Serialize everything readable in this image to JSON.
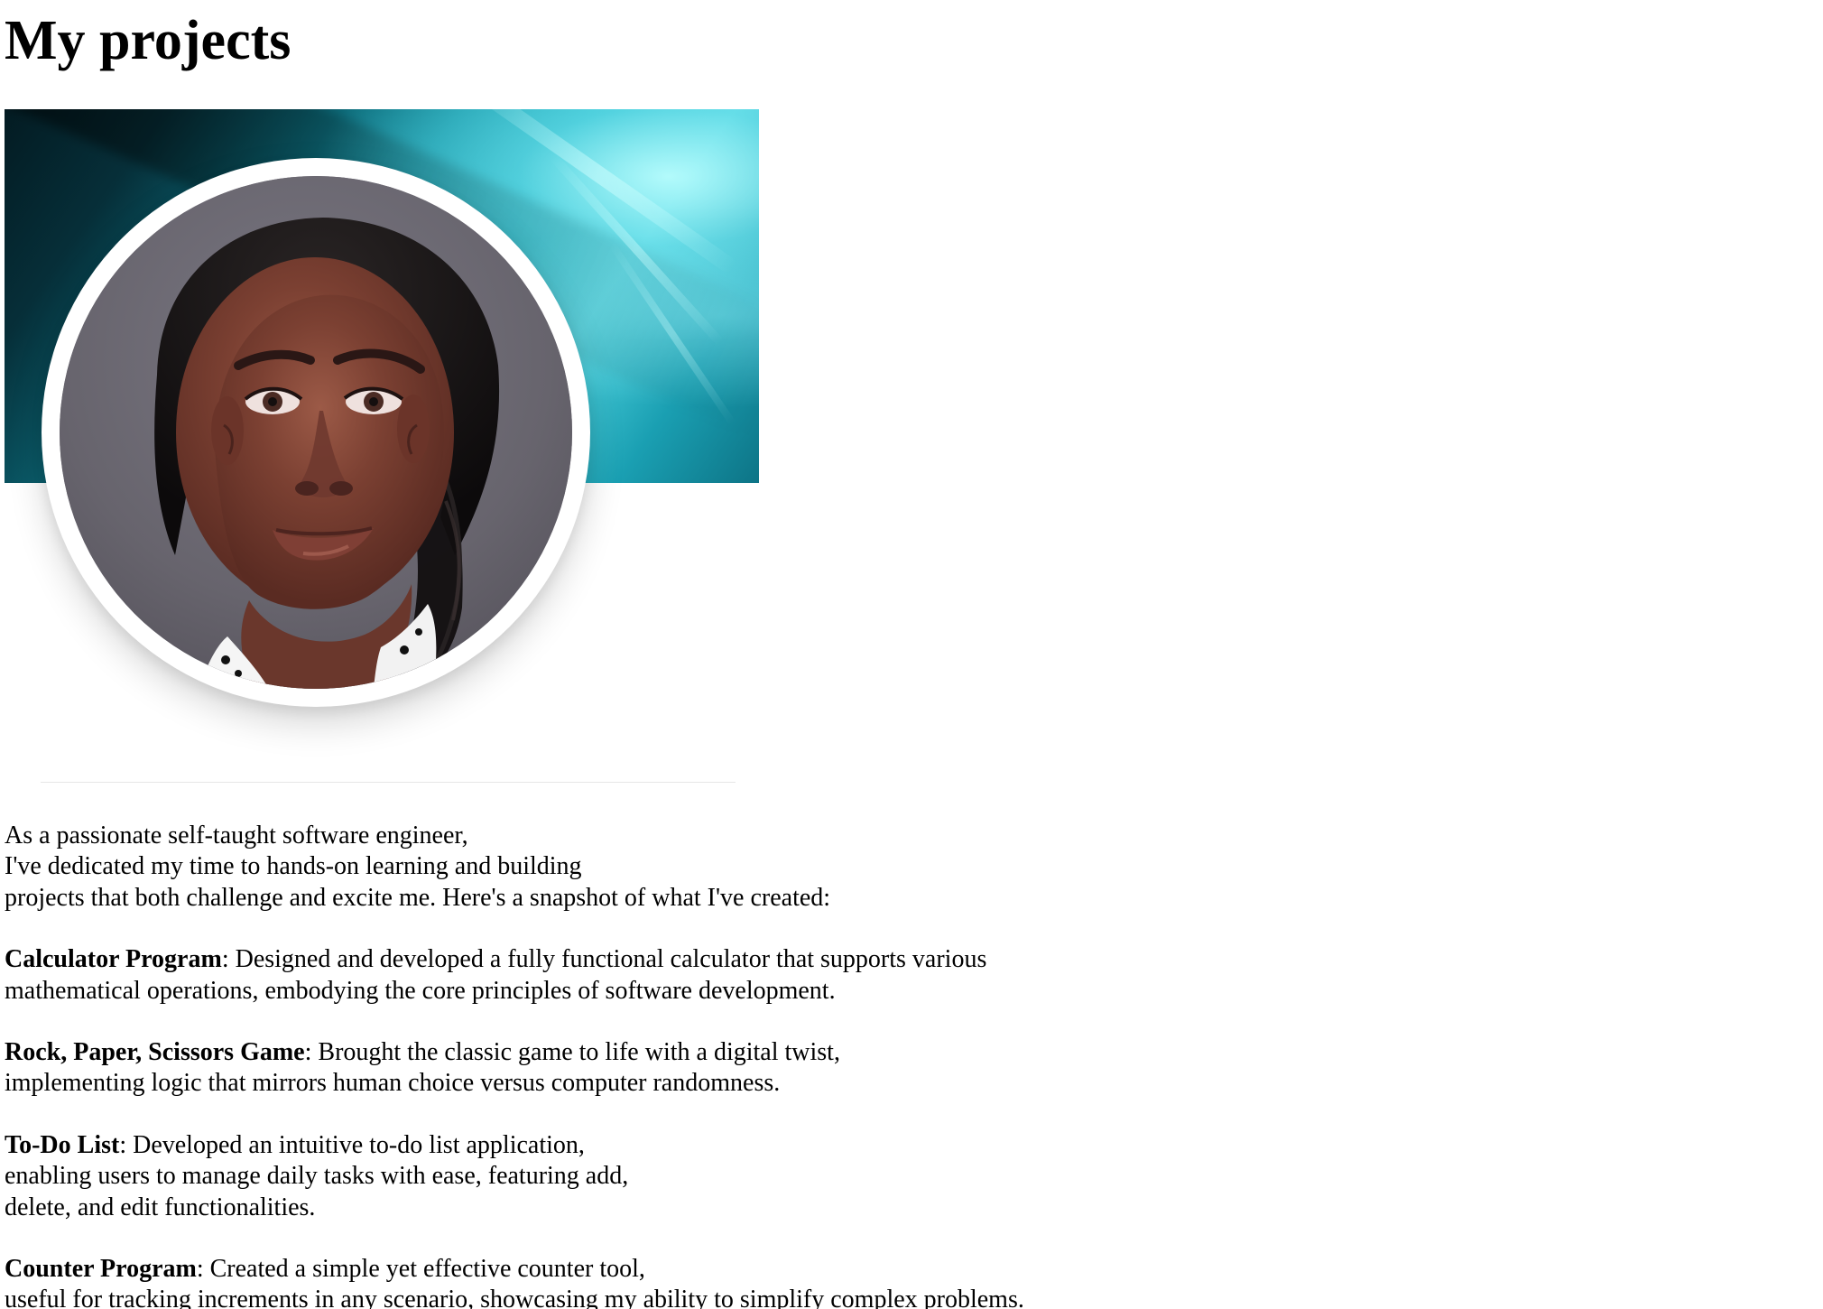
{
  "header": {
    "title": "My projects"
  },
  "intro": {
    "lines": [
      "As a passionate self-taught software engineer,",
      "I've dedicated my time to hands-on learning and building",
      "projects that both challenge and excite me. Here's a snapshot of what I've created:"
    ]
  },
  "projects": [
    {
      "name": "Calculator Program",
      "lines": [
        ": Designed and developed a fully functional calculator that supports various",
        "mathematical operations, embodying the core principles of software development."
      ]
    },
    {
      "name": "Rock, Paper, Scissors Game",
      "lines": [
        ": Brought the classic game to life with a digital twist,",
        "implementing logic that mirrors human choice versus computer randomness."
      ]
    },
    {
      "name": "To-Do List",
      "lines": [
        ": Developed an intuitive to-do list application,",
        "enabling users to manage daily tasks with ease, featuring add,",
        "delete, and edit functionalities."
      ]
    },
    {
      "name": "Counter Program",
      "lines": [
        ": Created a simple yet effective counter tool,",
        "useful for tracking increments in any scenario, showcasing my ability to simplify complex problems."
      ]
    }
  ]
}
